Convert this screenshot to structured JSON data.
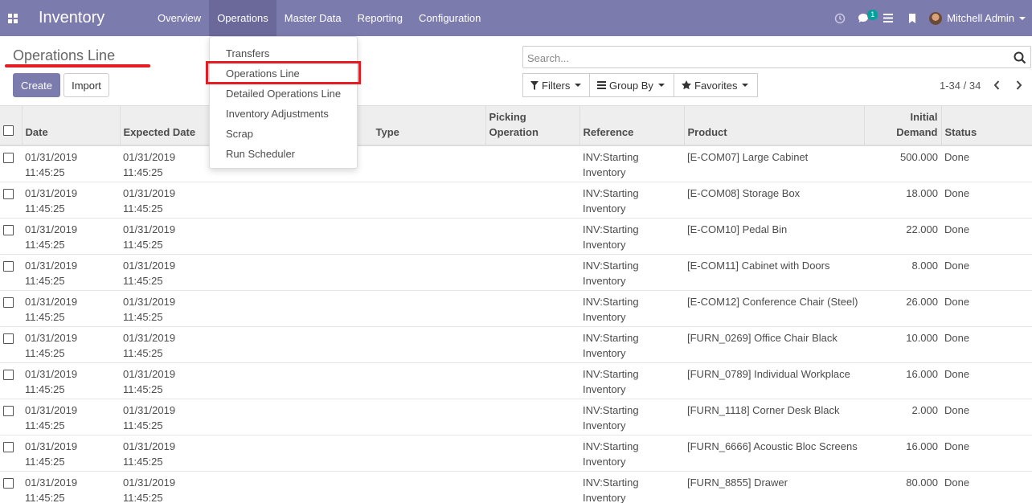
{
  "navbar": {
    "app_title": "Inventory",
    "menu": [
      "Overview",
      "Operations",
      "Master Data",
      "Reporting",
      "Configuration"
    ],
    "active_menu": "Operations",
    "chat_badge": "1",
    "user_name": "Mitchell Admin",
    "accent_color": "#7c7bad"
  },
  "control_panel": {
    "breadcrumb": "Operations Line",
    "create_label": "Create",
    "import_label": "Import",
    "search_placeholder": "Search...",
    "filters_label": "Filters",
    "group_by_label": "Group By",
    "favorites_label": "Favorites",
    "pager": "1-34 / 34"
  },
  "dropdown": {
    "items": [
      "Transfers",
      "Operations Line",
      "Detailed Operations Line",
      "Inventory Adjustments",
      "Scrap",
      "Run Scheduler"
    ],
    "highlighted": "Operations Line",
    "highlight_color": "#e41c23"
  },
  "table": {
    "columns": [
      "Date",
      "Expected Date",
      "Type",
      "Picking Operation",
      "Reference",
      "Product",
      "Initial Demand",
      "Status"
    ],
    "rows": [
      {
        "date": "01/31/2019",
        "date_time": "11:45:25",
        "expected": "01/31/2019",
        "expected_time": "11:45:25",
        "ref": "INV:Starting",
        "ref2": "Inventory",
        "product": "[E-COM07] Large Cabinet",
        "demand": "500.000",
        "status": "Done"
      },
      {
        "date": "01/31/2019",
        "date_time": "11:45:25",
        "expected": "01/31/2019",
        "expected_time": "11:45:25",
        "ref": "INV:Starting",
        "ref2": "Inventory",
        "product": "[E-COM08] Storage Box",
        "demand": "18.000",
        "status": "Done"
      },
      {
        "date": "01/31/2019",
        "date_time": "11:45:25",
        "expected": "01/31/2019",
        "expected_time": "11:45:25",
        "ref": "INV:Starting",
        "ref2": "Inventory",
        "product": "[E-COM10] Pedal Bin",
        "demand": "22.000",
        "status": "Done"
      },
      {
        "date": "01/31/2019",
        "date_time": "11:45:25",
        "expected": "01/31/2019",
        "expected_time": "11:45:25",
        "ref": "INV:Starting",
        "ref2": "Inventory",
        "product": "[E-COM11] Cabinet with Doors",
        "demand": "8.000",
        "status": "Done"
      },
      {
        "date": "01/31/2019",
        "date_time": "11:45:25",
        "expected": "01/31/2019",
        "expected_time": "11:45:25",
        "ref": "INV:Starting",
        "ref2": "Inventory",
        "product": "[E-COM12] Conference Chair (Steel)",
        "demand": "26.000",
        "status": "Done"
      },
      {
        "date": "01/31/2019",
        "date_time": "11:45:25",
        "expected": "01/31/2019",
        "expected_time": "11:45:25",
        "ref": "INV:Starting",
        "ref2": "Inventory",
        "product": "[FURN_0269] Office Chair Black",
        "demand": "10.000",
        "status": "Done"
      },
      {
        "date": "01/31/2019",
        "date_time": "11:45:25",
        "expected": "01/31/2019",
        "expected_time": "11:45:25",
        "ref": "INV:Starting",
        "ref2": "Inventory",
        "product": "[FURN_0789] Individual Workplace",
        "demand": "16.000",
        "status": "Done"
      },
      {
        "date": "01/31/2019",
        "date_time": "11:45:25",
        "expected": "01/31/2019",
        "expected_time": "11:45:25",
        "ref": "INV:Starting",
        "ref2": "Inventory",
        "product": "[FURN_1118] Corner Desk Black",
        "demand": "2.000",
        "status": "Done"
      },
      {
        "date": "01/31/2019",
        "date_time": "11:45:25",
        "expected": "01/31/2019",
        "expected_time": "11:45:25",
        "ref": "INV:Starting",
        "ref2": "Inventory",
        "product": "[FURN_6666] Acoustic Bloc Screens",
        "demand": "16.000",
        "status": "Done"
      },
      {
        "date": "01/31/2019",
        "date_time": "11:45:25",
        "expected": "01/31/2019",
        "expected_time": "11:45:25",
        "ref": "INV:Starting",
        "ref2": "Inventory",
        "product": "[FURN_8855] Drawer",
        "demand": "80.000",
        "status": "Done"
      }
    ]
  }
}
